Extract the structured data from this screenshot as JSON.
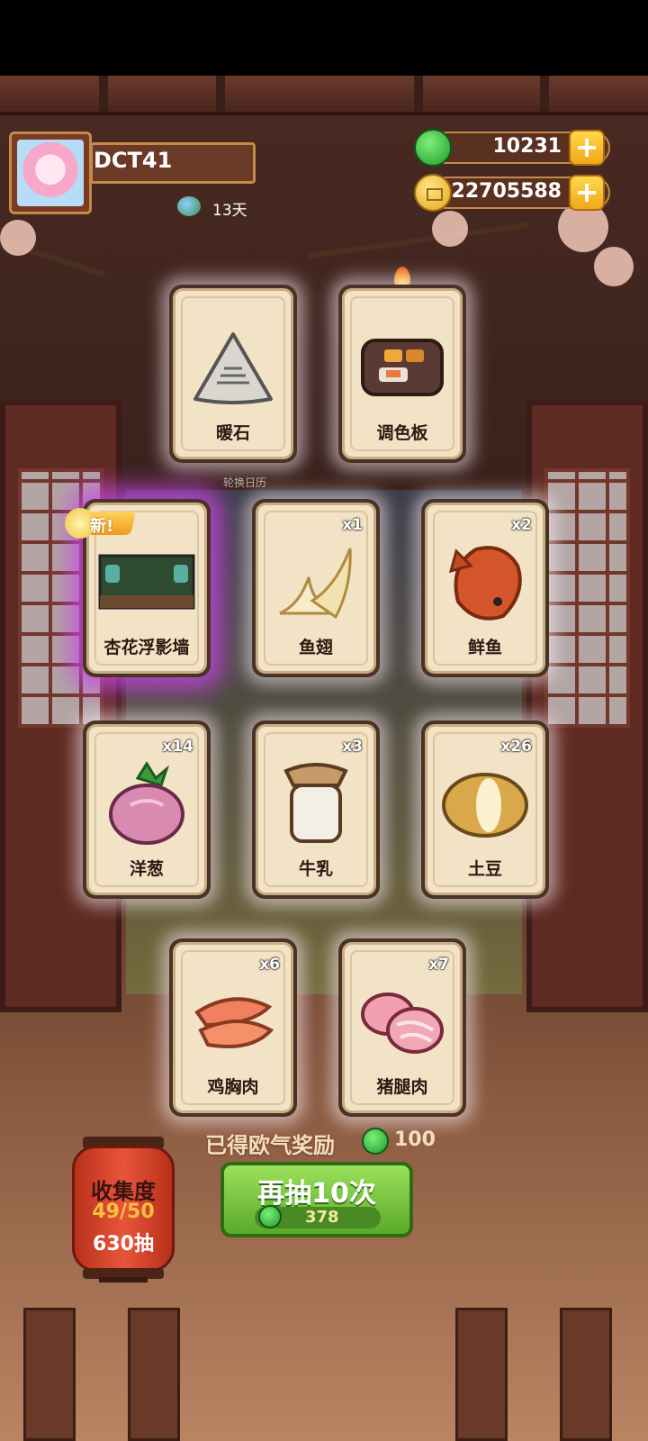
{
  "player": {
    "name": "DCT41",
    "days": "13天"
  },
  "currency": {
    "gems": "10231",
    "coins": "22705588",
    "plus_label": "+"
  },
  "banner_label": "轮换日历",
  "cards": [
    {
      "name": "暖石",
      "count": "",
      "icon": "warm-stone"
    },
    {
      "name": "调色板",
      "count": "",
      "icon": "palette"
    },
    {
      "name": "杏花浮影墙",
      "count": "",
      "icon": "wall",
      "badge": "新!"
    },
    {
      "name": "鱼翅",
      "count": "x1",
      "icon": "shark-fin"
    },
    {
      "name": "鲜鱼",
      "count": "x2",
      "icon": "fish"
    },
    {
      "name": "洋葱",
      "count": "x14",
      "icon": "onion"
    },
    {
      "name": "牛乳",
      "count": "x3",
      "icon": "milk"
    },
    {
      "name": "土豆",
      "count": "x26",
      "icon": "potato"
    },
    {
      "name": "鸡胸肉",
      "count": "x6",
      "icon": "chicken"
    },
    {
      "name": "猪腿肉",
      "count": "x7",
      "icon": "pork"
    }
  ],
  "reward": {
    "label": "已得欧气奖励",
    "value": "100"
  },
  "draw": {
    "label": "再抽10次",
    "cost": "378"
  },
  "collection": {
    "title": "收集度",
    "progress": "49/50",
    "draws": "630抽"
  },
  "colors": {
    "accent_green": "#5aaa2a",
    "gold": "#f0a81a",
    "new_glow": "#c846e6"
  }
}
